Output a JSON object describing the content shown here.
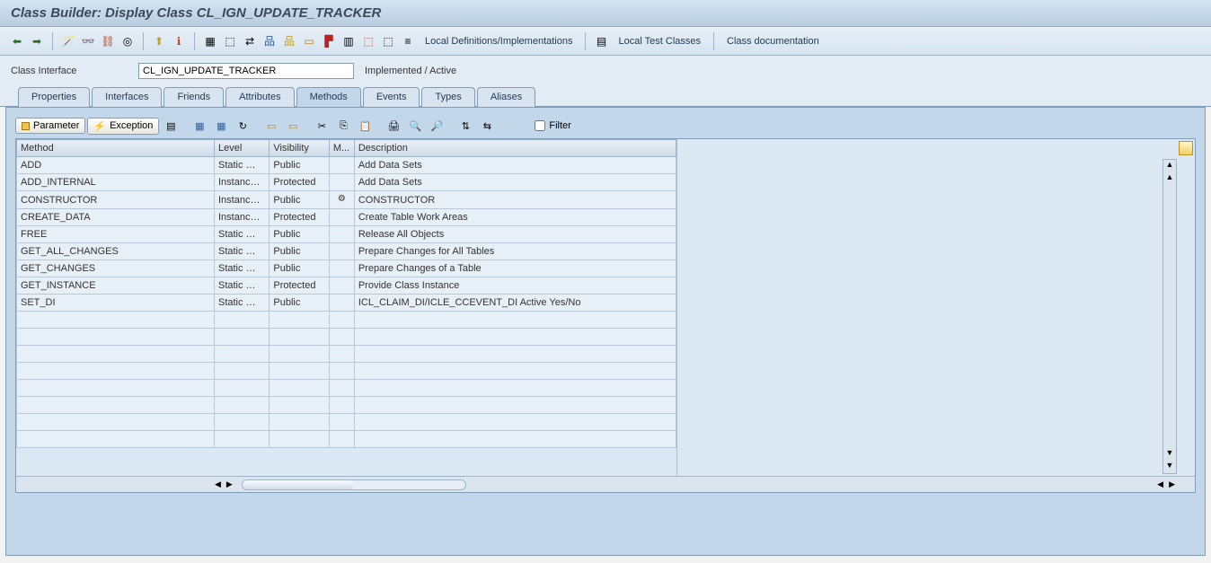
{
  "title": "Class Builder: Display Class CL_IGN_UPDATE_TRACKER",
  "toolbar_links": {
    "local_defs": "Local Definitions/Implementations",
    "local_test": "Local Test Classes",
    "class_doc": "Class documentation"
  },
  "form": {
    "label": "Class Interface",
    "value": "CL_IGN_UPDATE_TRACKER",
    "status": "Implemented / Active"
  },
  "tabs": [
    "Properties",
    "Interfaces",
    "Friends",
    "Attributes",
    "Methods",
    "Events",
    "Types",
    "Aliases"
  ],
  "active_tab": "Methods",
  "inner_toolbar": {
    "parameter": "Parameter",
    "exception": "Exception",
    "filter_label": "Filter"
  },
  "grid": {
    "headers": [
      "Method",
      "Level",
      "Visibility",
      "M...",
      "Description"
    ],
    "rows": [
      {
        "method": "ADD",
        "level": "Static …",
        "visibility": "Public",
        "m": "",
        "desc": "Add Data Sets"
      },
      {
        "method": "ADD_INTERNAL",
        "level": "Instanc…",
        "visibility": "Protected",
        "m": "",
        "desc": "Add Data Sets"
      },
      {
        "method": "CONSTRUCTOR",
        "level": "Instanc…",
        "visibility": "Public",
        "m": "icon",
        "desc": "CONSTRUCTOR"
      },
      {
        "method": "CREATE_DATA",
        "level": "Instanc…",
        "visibility": "Protected",
        "m": "",
        "desc": "Create Table Work Areas"
      },
      {
        "method": "FREE",
        "level": "Static …",
        "visibility": "Public",
        "m": "",
        "desc": "Release All Objects"
      },
      {
        "method": "GET_ALL_CHANGES",
        "level": "Static …",
        "visibility": "Public",
        "m": "",
        "desc": "Prepare Changes for All Tables"
      },
      {
        "method": "GET_CHANGES",
        "level": "Static …",
        "visibility": "Public",
        "m": "",
        "desc": "Prepare Changes of a Table"
      },
      {
        "method": "GET_INSTANCE",
        "level": "Static …",
        "visibility": "Protected",
        "m": "",
        "desc": "Provide Class Instance"
      },
      {
        "method": "SET_DI",
        "level": "Static …",
        "visibility": "Public",
        "m": "",
        "desc": "ICL_CLAIM_DI/ICLE_CCEVENT_DI Active Yes/No"
      }
    ],
    "empty_rows": 8
  }
}
